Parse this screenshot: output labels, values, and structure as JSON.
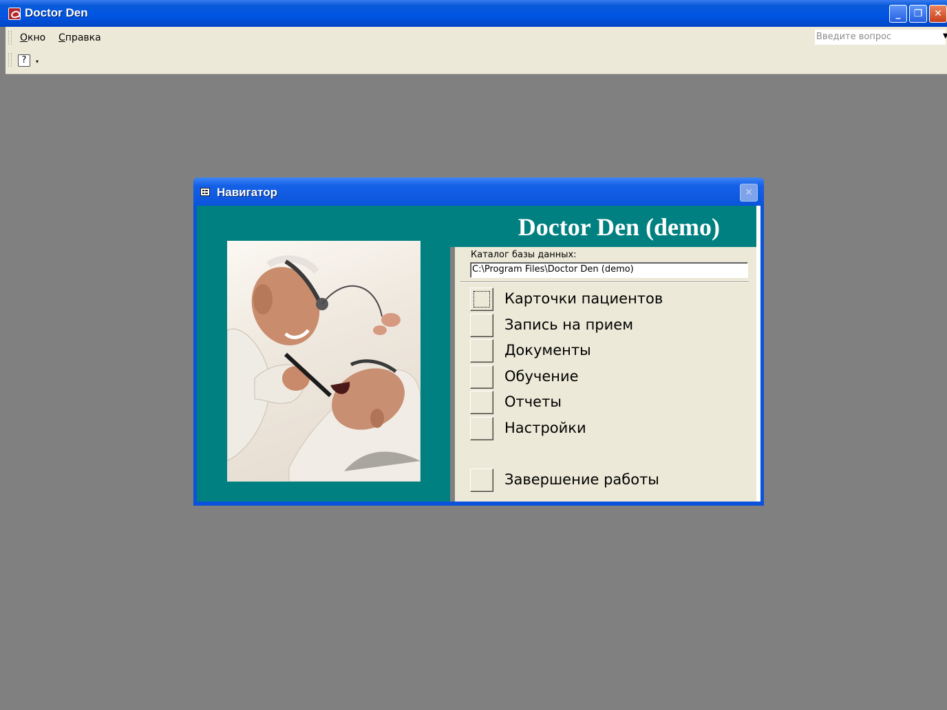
{
  "app": {
    "title": "Doctor Den",
    "window_controls": {
      "minimize": "_",
      "restore": "❐",
      "close": "✕"
    }
  },
  "menubar": {
    "items": [
      {
        "label_u": "О",
        "label_rest": "кно"
      },
      {
        "label_u": "С",
        "label_rest": "правка"
      }
    ],
    "question_placeholder": "Введите вопрос",
    "question_dropdown": "▼"
  },
  "toolbar": {
    "help_icon_glyph": "?",
    "help_dropdown": "▾"
  },
  "navigator": {
    "title": "Навигатор",
    "close_glyph": "✕",
    "header_title": "Doctor Den (demo)",
    "db_label": "Каталог базы данных:",
    "db_path": "C:\\Program Files\\Doctor Den (demo)",
    "buttons": [
      {
        "label": "Карточки пациентов"
      },
      {
        "label": "Запись на прием"
      },
      {
        "label": "Документы"
      },
      {
        "label": "Обучение"
      },
      {
        "label": "Отчеты"
      },
      {
        "label": "Настройки"
      },
      {
        "label": "Завершение работы"
      }
    ],
    "colors": {
      "teal": "#008080",
      "face": "#ece9d8",
      "titlebar": "#0a55dc"
    }
  },
  "icons": [
    "app-icon",
    "window-icon",
    "help-icon",
    "close-icon",
    "minimize-icon",
    "restore-icon",
    "picture-dentist"
  ]
}
